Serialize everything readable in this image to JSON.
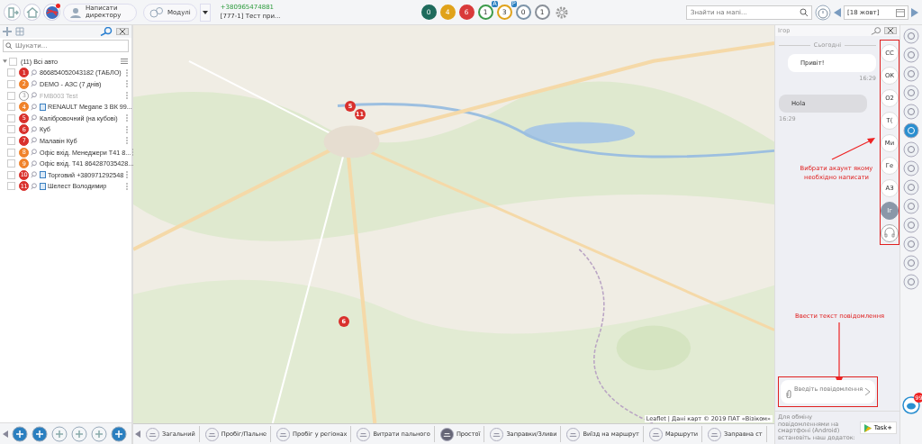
{
  "topbar": {
    "write_director": "Написати директору",
    "modules": "Модулі",
    "phone": "+380965474881",
    "account": "[777-1] Тест при...",
    "counters": [
      {
        "value": "0",
        "kind": "filled",
        "color": "#1f6b5c"
      },
      {
        "value": "4",
        "kind": "filled",
        "color": "#e0a21a"
      },
      {
        "value": "6",
        "kind": "filled",
        "color": "#d93a3a"
      },
      {
        "value": "1",
        "kind": "outline",
        "color": "#3c9a4a",
        "badge": "A"
      },
      {
        "value": "3",
        "kind": "outline",
        "color": "#e0a21a",
        "badge": "P"
      },
      {
        "value": "0",
        "kind": "outline",
        "color": "#7d94a8"
      },
      {
        "value": "1",
        "kind": "outline",
        "color": "#8a9099"
      }
    ],
    "map_search": {
      "placeholder": "Знайти на мапі..."
    },
    "date": "[18 жовт]"
  },
  "sidebar": {
    "search": {
      "placeholder": "Шукати..."
    },
    "root": {
      "label": "(11) Всі авто",
      "checked": false,
      "children": [
        {
          "number": "1",
          "color": "#d9302c",
          "name": "866854052043182 (ТАБЛО)",
          "online": true,
          "card": false,
          "checked": false
        },
        {
          "number": "2",
          "color": "#f0822a",
          "name": "DEMO - АЗС (7 днів)",
          "online": true,
          "card": false,
          "checked": false
        },
        {
          "number": "3",
          "color": "#9a9a9a",
          "name": "FMB003 Test",
          "online": false,
          "card": false,
          "checked": false
        },
        {
          "number": "4",
          "color": "#f0822a",
          "name": "RENAULT Megane 3 ВК 99...",
          "online": true,
          "card": true,
          "checked": false
        },
        {
          "number": "5",
          "color": "#d9302c",
          "name": "Калібровочний (на кубові)",
          "online": true,
          "card": false,
          "checked": false
        },
        {
          "number": "6",
          "color": "#d9302c",
          "name": "Куб",
          "online": true,
          "card": false,
          "checked": false
        },
        {
          "number": "7",
          "color": "#d9302c",
          "name": "Малавін Куб",
          "online": true,
          "card": false,
          "checked": false
        },
        {
          "number": "8",
          "color": "#f0822a",
          "name": "Офіс вхід. Менеджери Т41 8...",
          "online": true,
          "card": false,
          "checked": false
        },
        {
          "number": "9",
          "color": "#f0822a",
          "name": "Офіс вхід. Т41 864287035428...",
          "online": true,
          "card": false,
          "checked": false
        },
        {
          "number": "10",
          "color": "#d9302c",
          "name": "Торговий +380971292548",
          "online": true,
          "card": true,
          "checked": false
        },
        {
          "number": "11",
          "color": "#d9302c",
          "name": "Шелест Володимир",
          "online": true,
          "card": true,
          "checked": false
        }
      ]
    }
  },
  "map": {
    "markers": [
      {
        "label": "5",
        "color": "#d9302c"
      },
      {
        "label": "11",
        "color": "#d9302c"
      },
      {
        "label": "6",
        "color": "#d9302c"
      }
    ],
    "attribution": "Leaflet | Дані карт © 2019 ПАТ «Візіком»"
  },
  "chat": {
    "contact": "Ігор",
    "day": "Сьогодні",
    "messages": [
      {
        "text": "Привіт!",
        "time": "16:29",
        "kind": "outgoing"
      },
      {
        "text": "Hola",
        "time": "16:29",
        "kind": "incoming"
      }
    ],
    "accounts": [
      {
        "initials": "СС",
        "selected": false
      },
      {
        "initials": "ОК",
        "selected": false
      },
      {
        "initials": "О2",
        "selected": false
      },
      {
        "initials": "Т(",
        "selected": false
      },
      {
        "initials": "Ми",
        "selected": false
      },
      {
        "initials": "Ге",
        "selected": false
      },
      {
        "initials": "АЗ",
        "selected": false
      },
      {
        "initials": "Іг",
        "selected": true
      }
    ],
    "input": {
      "placeholder": "Введіть повідомлення"
    },
    "footer": "Для обміну повідомленнями на смартфоні (Android) встановіть наш додаток:",
    "store_button": "Task+"
  },
  "annotations": [
    "Вибрати акаунт якому необхідно написати",
    "Ввести текст повідомлення"
  ],
  "reports": [
    "Загальний",
    "Пробіг/Пальне",
    "Пробіг у регіонах",
    "Витрати пального",
    "Простої",
    "Заправки/Зливи",
    "Виїзд на маршрут",
    "Маршрути",
    "Заправна ст"
  ],
  "notifications": {
    "badge": "99"
  }
}
